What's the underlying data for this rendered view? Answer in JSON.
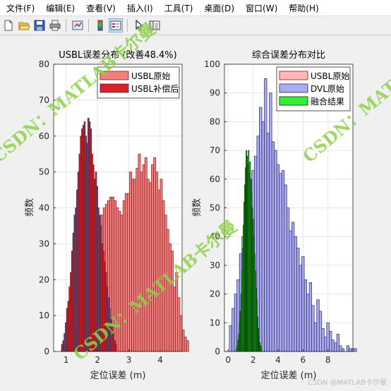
{
  "menu": [
    "文件(F)",
    "编辑(E)",
    "查看(V)",
    "插入(I)",
    "工具(T)",
    "桌面(D)",
    "窗口(W)",
    "帮助(H)"
  ],
  "toolbar_icons": [
    "new-file-icon",
    "open-folder-icon",
    "save-icon",
    "print-icon",
    "link-plot-icon",
    "insert-colorbar-icon",
    "insert-legend-icon",
    "pointer-icon",
    "property-editor-icon"
  ],
  "watermark": {
    "text": "CSDN：MATLAB卡尔曼",
    "color": "#8fd14a"
  },
  "footer_credit": "CSDN @MATLAB卡尔曼",
  "chart_data": [
    {
      "type": "bar",
      "title": "USBL误差分布 (改善48.4%)",
      "xlabel": "定位误差 (m)",
      "ylabel": "频数",
      "xlim": [
        0.6,
        4.7
      ],
      "ylim": [
        0,
        80
      ],
      "xticks": [
        1,
        2,
        3,
        4
      ],
      "yticks": [
        0,
        10,
        20,
        30,
        40,
        50,
        60,
        70,
        80
      ],
      "grid": true,
      "legend_position": "top-right",
      "series": [
        {
          "name": "USBL原始",
          "color": "#f08080",
          "bin_start": 0.85,
          "bin_width": 0.07,
          "values": [
            1,
            2,
            3,
            4,
            6,
            8,
            10,
            11,
            10,
            14,
            16,
            18,
            22,
            24,
            25,
            30,
            33,
            35,
            38,
            40,
            41,
            42,
            43,
            43,
            42,
            40,
            39,
            38,
            42,
            44,
            44,
            50,
            48,
            48,
            51,
            55,
            50,
            52,
            54,
            48,
            47,
            52,
            54,
            50,
            45,
            48,
            42,
            38,
            34,
            30,
            28,
            18,
            22,
            15,
            10,
            6,
            4,
            3
          ]
        },
        {
          "name": "USBL补偿后",
          "color": "#dc2222",
          "bin_start": 0.85,
          "bin_width": 0.04,
          "values": [
            2,
            3,
            5,
            8,
            12,
            14,
            18,
            22,
            28,
            33,
            38,
            40,
            45,
            50,
            55,
            60,
            62,
            63,
            64,
            60,
            58,
            65,
            64,
            62,
            55,
            52,
            48,
            50,
            46,
            40,
            38,
            35,
            30,
            28,
            25,
            22,
            18,
            15,
            12,
            9,
            7,
            5,
            3,
            2
          ]
        }
      ]
    },
    {
      "type": "bar",
      "title": "综合误差分布对比",
      "xlabel": "定位误差 (m)",
      "ylabel": "频数",
      "xlim": [
        -0.3,
        10
      ],
      "ylim": [
        0,
        100
      ],
      "xticks": [
        0,
        2,
        4,
        6,
        8
      ],
      "yticks": [
        0,
        10,
        20,
        30,
        40,
        50,
        60,
        70,
        80,
        90,
        100
      ],
      "grid": true,
      "legend_position": "top-right",
      "series": [
        {
          "name": "USBL原始",
          "color": "#ffb8b8",
          "bin_start": 0.85,
          "bin_width": 0.14,
          "values": [
            2,
            4,
            8,
            12,
            18,
            22,
            30,
            38,
            45,
            52,
            58,
            62,
            66,
            64,
            60,
            56,
            48,
            40,
            34,
            28,
            22,
            15,
            10,
            6,
            4,
            3,
            2,
            1,
            1
          ]
        },
        {
          "name": "DVL原始",
          "color": "#aaaaf5",
          "bin_start": 0.1,
          "bin_width": 0.2,
          "values": [
            9,
            15,
            20,
            25,
            34,
            40,
            45,
            52,
            60,
            63,
            68,
            75,
            85,
            80,
            95,
            76,
            90,
            73,
            70,
            65,
            62,
            63,
            58,
            50,
            42,
            45,
            40,
            36,
            30,
            33,
            25,
            20,
            24,
            16,
            10,
            18,
            14,
            8,
            5,
            10,
            7,
            4,
            3,
            6,
            2,
            1,
            0,
            2,
            1,
            1,
            1
          ]
        },
        {
          "name": "融合结果",
          "color": "#33ee33",
          "bin_start": 0.65,
          "bin_width": 0.06,
          "values": [
            1,
            2,
            4,
            6,
            10,
            14,
            20,
            28,
            36,
            44,
            52,
            58,
            64,
            70,
            68,
            65,
            70,
            62,
            66,
            60,
            55,
            50,
            46,
            40,
            34,
            28,
            22,
            18,
            12,
            8,
            5,
            3,
            2,
            1
          ]
        }
      ]
    }
  ]
}
